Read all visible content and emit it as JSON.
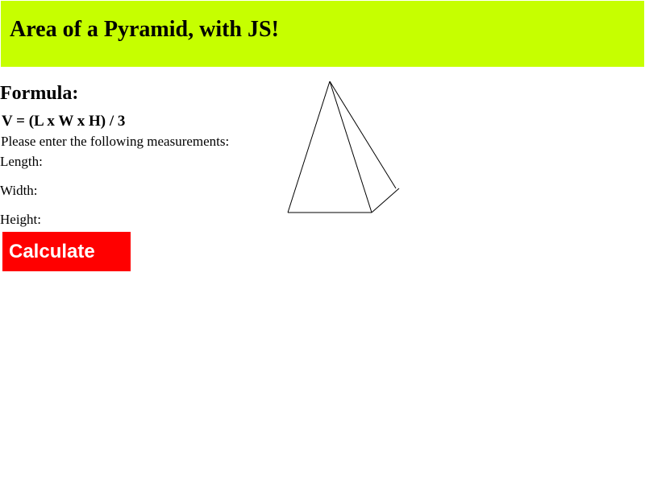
{
  "header": {
    "title": "Area of a Pyramid, with JS!",
    "background_color": "#c6ff00"
  },
  "formula": {
    "heading": "Formula:",
    "equation": "V = (L x W x H) / 3"
  },
  "form": {
    "instructions": "Please enter the following measurements:",
    "length_label": "Length:",
    "width_label": "Width:",
    "height_label": "Height:",
    "calculate_label": "Calculate",
    "button_color": "#ff0000"
  },
  "illustration": {
    "icon": "pyramid-icon"
  }
}
